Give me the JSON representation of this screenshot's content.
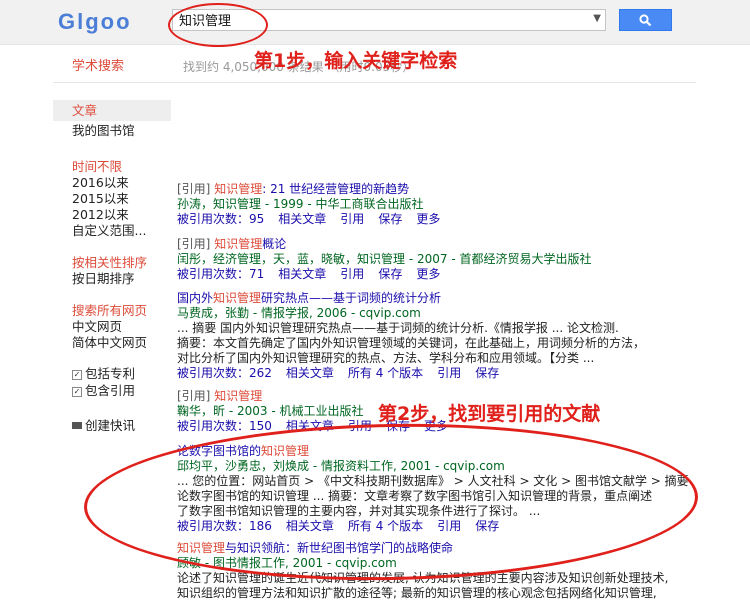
{
  "header": {
    "logo": "Glgoo",
    "search_value": "知识管理",
    "scholar_label": "学术搜索",
    "result_count": "找到约 4,050,000 条结果 （用时0.05秒）"
  },
  "sidebar": {
    "articles": "文章",
    "my_library": "我的图书馆",
    "time_any": "时间不限",
    "since_2016": "2016以来",
    "since_2015": "2015以来",
    "since_2012": "2012以来",
    "custom_range": "自定义范围...",
    "sort_relevance": "按相关性排序",
    "sort_date": "按日期排序",
    "search_all": "搜索所有网页",
    "chinese_web": "中文网页",
    "simplified_web": "简体中文网页",
    "include_patents": "包括专利",
    "include_citations": "包含引用",
    "create_alert": "创建快讯"
  },
  "annotations": {
    "step1": "第1步，输入关键字检索",
    "step2": "第2步，找到要引用的文献"
  },
  "results": [
    {
      "tag": "[引用]",
      "title_hl": "知识管理",
      "title_rest": ": 21 世纪经营管理的新趋势",
      "src": "孙涛，知识管理 - 1999 - 中华工商联合出版社",
      "links": [
        "被引用次数：95",
        "相关文章",
        "引用",
        "保存",
        "更多"
      ]
    },
    {
      "tag": "[引用]",
      "title_hl": "知识管理",
      "title_rest": "概论",
      "src": "闰彤，经济管理，天，蓝，晓敏，知识管理 - 2007 - 首都经济贸易大学出版社",
      "links": [
        "被引用次数：71",
        "相关文章",
        "引用",
        "保存",
        "更多"
      ]
    },
    {
      "title_pre": "国内外",
      "title_hl": "知识管理",
      "title_rest": "研究热点——基于词频的统计分析",
      "src": "马费成，张勤 - 情报学报, 2006 - cqvip.com",
      "snip1": "... 摘要 国内外知识管理研究热点——基于词频的统计分析.《情报学报 ... 论文检测.",
      "snip2": "摘要：本文首先确定了国内外知识管理领域的关键词，在此基础上，用词频分析的方法，",
      "snip3": "对比分析了国内外知识管理研究的热点、方法、学科分布和应用领域。【分类 ...",
      "links": [
        "被引用次数：262",
        "相关文章",
        "所有 4 个版本",
        "引用",
        "保存"
      ]
    },
    {
      "tag": "[引用]",
      "title_hl": "知识管理",
      "title_rest": "",
      "src": "鞠华，昕 - 2003 - 机械工业出版社",
      "links": [
        "被引用次数：150",
        "相关文章",
        "引用",
        "保存",
        "更多"
      ]
    },
    {
      "title_pre": "论数字图书馆的",
      "title_hl": "知识管理",
      "title_rest": "",
      "src": "邱均平，沙勇忠，刘焕成 - 情报资料工作, 2001 - cqvip.com",
      "snip1": "... 您的位置：网站首页 > 《中文科技期刊数据库》 > 人文社科 > 文化 > 图书馆文献学 > 摘要",
      "snip2": "论数字图书馆的知识管理 ... 摘要：文章考察了数字图书馆引入知识管理的背景，重点阐述",
      "snip3": "了数字图书馆知识管理的主要内容，并对其实现条件进行了探讨。 ...",
      "links": [
        "被引用次数：186",
        "相关文章",
        "所有 4 个版本",
        "引用",
        "保存"
      ]
    },
    {
      "title_hl": "知识管理",
      "title_rest": "与知识领航：新世纪图书馆学门的战略使命",
      "src": "顾敏 - 图书情报工作, 2001 - cqvip.com",
      "snip1": "论述了知识管理的诞生近代知识管理的发展, 认为知识管理的主要内容涉及知识创新处理技术,",
      "snip2": "知识组织的管理方法和知识扩散的途径等; 最新的知识管理的核心观念包括网络化知识管理,"
    }
  ],
  "colors": {
    "accent_red": "#dd4b39",
    "link_blue": "#1a0dab",
    "source_green": "#006621",
    "button_blue": "#4a8af4",
    "annotation_red": "#e0201b"
  }
}
